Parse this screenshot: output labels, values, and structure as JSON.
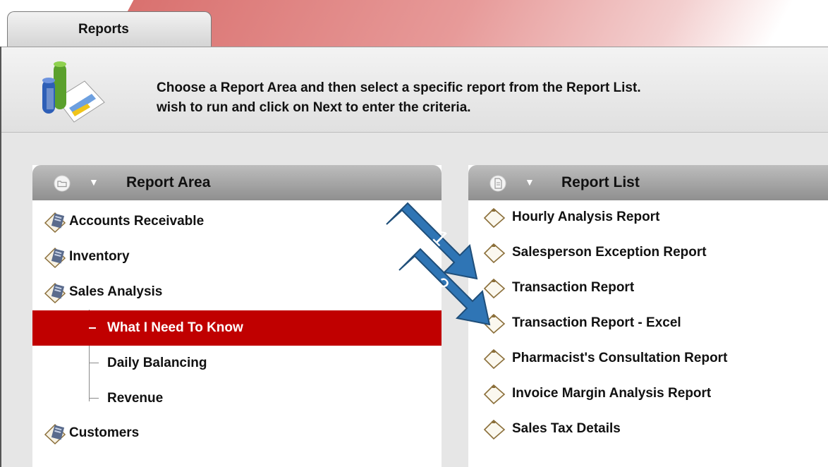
{
  "tab": {
    "label": "Reports"
  },
  "instructions": {
    "line1": "Choose a Report Area and then select a specific report from the Report List.",
    "line2": "wish to run and click on Next to enter the criteria."
  },
  "report_area": {
    "title": "Report Area",
    "items": [
      {
        "label": "Accounts Receivable"
      },
      {
        "label": "Inventory"
      },
      {
        "label": "Sales Analysis"
      },
      {
        "label": "Customers"
      }
    ],
    "sub_items": [
      {
        "label": "What I Need To Know",
        "selected": true
      },
      {
        "label": "Daily Balancing",
        "selected": false
      },
      {
        "label": "Revenue",
        "selected": false
      }
    ]
  },
  "report_list": {
    "title": "Report List",
    "items": [
      {
        "label": "Hourly Analysis Report"
      },
      {
        "label": "Salesperson Exception Report"
      },
      {
        "label": "Transaction Report"
      },
      {
        "label": "Transaction Report - Excel"
      },
      {
        "label": "Pharmacist's Consultation Report"
      },
      {
        "label": "Invoice Margin Analysis Report"
      },
      {
        "label": "Sales Tax Details"
      }
    ]
  },
  "annotations": {
    "arrow1": "1",
    "arrow2": "2",
    "arrow_color": "#2f75b5"
  },
  "colors": {
    "selected_bg": "#c00000"
  }
}
